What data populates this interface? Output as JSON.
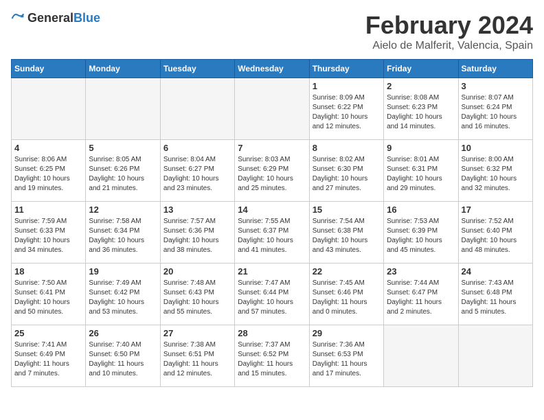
{
  "header": {
    "logo_general": "General",
    "logo_blue": "Blue",
    "month_title": "February 2024",
    "location": "Aielo de Malferit, Valencia, Spain"
  },
  "weekdays": [
    "Sunday",
    "Monday",
    "Tuesday",
    "Wednesday",
    "Thursday",
    "Friday",
    "Saturday"
  ],
  "weeks": [
    [
      {
        "day": "",
        "info": ""
      },
      {
        "day": "",
        "info": ""
      },
      {
        "day": "",
        "info": ""
      },
      {
        "day": "",
        "info": ""
      },
      {
        "day": "1",
        "info": "Sunrise: 8:09 AM\nSunset: 6:22 PM\nDaylight: 10 hours\nand 12 minutes."
      },
      {
        "day": "2",
        "info": "Sunrise: 8:08 AM\nSunset: 6:23 PM\nDaylight: 10 hours\nand 14 minutes."
      },
      {
        "day": "3",
        "info": "Sunrise: 8:07 AM\nSunset: 6:24 PM\nDaylight: 10 hours\nand 16 minutes."
      }
    ],
    [
      {
        "day": "4",
        "info": "Sunrise: 8:06 AM\nSunset: 6:25 PM\nDaylight: 10 hours\nand 19 minutes."
      },
      {
        "day": "5",
        "info": "Sunrise: 8:05 AM\nSunset: 6:26 PM\nDaylight: 10 hours\nand 21 minutes."
      },
      {
        "day": "6",
        "info": "Sunrise: 8:04 AM\nSunset: 6:27 PM\nDaylight: 10 hours\nand 23 minutes."
      },
      {
        "day": "7",
        "info": "Sunrise: 8:03 AM\nSunset: 6:29 PM\nDaylight: 10 hours\nand 25 minutes."
      },
      {
        "day": "8",
        "info": "Sunrise: 8:02 AM\nSunset: 6:30 PM\nDaylight: 10 hours\nand 27 minutes."
      },
      {
        "day": "9",
        "info": "Sunrise: 8:01 AM\nSunset: 6:31 PM\nDaylight: 10 hours\nand 29 minutes."
      },
      {
        "day": "10",
        "info": "Sunrise: 8:00 AM\nSunset: 6:32 PM\nDaylight: 10 hours\nand 32 minutes."
      }
    ],
    [
      {
        "day": "11",
        "info": "Sunrise: 7:59 AM\nSunset: 6:33 PM\nDaylight: 10 hours\nand 34 minutes."
      },
      {
        "day": "12",
        "info": "Sunrise: 7:58 AM\nSunset: 6:34 PM\nDaylight: 10 hours\nand 36 minutes."
      },
      {
        "day": "13",
        "info": "Sunrise: 7:57 AM\nSunset: 6:36 PM\nDaylight: 10 hours\nand 38 minutes."
      },
      {
        "day": "14",
        "info": "Sunrise: 7:55 AM\nSunset: 6:37 PM\nDaylight: 10 hours\nand 41 minutes."
      },
      {
        "day": "15",
        "info": "Sunrise: 7:54 AM\nSunset: 6:38 PM\nDaylight: 10 hours\nand 43 minutes."
      },
      {
        "day": "16",
        "info": "Sunrise: 7:53 AM\nSunset: 6:39 PM\nDaylight: 10 hours\nand 45 minutes."
      },
      {
        "day": "17",
        "info": "Sunrise: 7:52 AM\nSunset: 6:40 PM\nDaylight: 10 hours\nand 48 minutes."
      }
    ],
    [
      {
        "day": "18",
        "info": "Sunrise: 7:50 AM\nSunset: 6:41 PM\nDaylight: 10 hours\nand 50 minutes."
      },
      {
        "day": "19",
        "info": "Sunrise: 7:49 AM\nSunset: 6:42 PM\nDaylight: 10 hours\nand 53 minutes."
      },
      {
        "day": "20",
        "info": "Sunrise: 7:48 AM\nSunset: 6:43 PM\nDaylight: 10 hours\nand 55 minutes."
      },
      {
        "day": "21",
        "info": "Sunrise: 7:47 AM\nSunset: 6:44 PM\nDaylight: 10 hours\nand 57 minutes."
      },
      {
        "day": "22",
        "info": "Sunrise: 7:45 AM\nSunset: 6:46 PM\nDaylight: 11 hours\nand 0 minutes."
      },
      {
        "day": "23",
        "info": "Sunrise: 7:44 AM\nSunset: 6:47 PM\nDaylight: 11 hours\nand 2 minutes."
      },
      {
        "day": "24",
        "info": "Sunrise: 7:43 AM\nSunset: 6:48 PM\nDaylight: 11 hours\nand 5 minutes."
      }
    ],
    [
      {
        "day": "25",
        "info": "Sunrise: 7:41 AM\nSunset: 6:49 PM\nDaylight: 11 hours\nand 7 minutes."
      },
      {
        "day": "26",
        "info": "Sunrise: 7:40 AM\nSunset: 6:50 PM\nDaylight: 11 hours\nand 10 minutes."
      },
      {
        "day": "27",
        "info": "Sunrise: 7:38 AM\nSunset: 6:51 PM\nDaylight: 11 hours\nand 12 minutes."
      },
      {
        "day": "28",
        "info": "Sunrise: 7:37 AM\nSunset: 6:52 PM\nDaylight: 11 hours\nand 15 minutes."
      },
      {
        "day": "29",
        "info": "Sunrise: 7:36 AM\nSunset: 6:53 PM\nDaylight: 11 hours\nand 17 minutes."
      },
      {
        "day": "",
        "info": ""
      },
      {
        "day": "",
        "info": ""
      }
    ]
  ]
}
